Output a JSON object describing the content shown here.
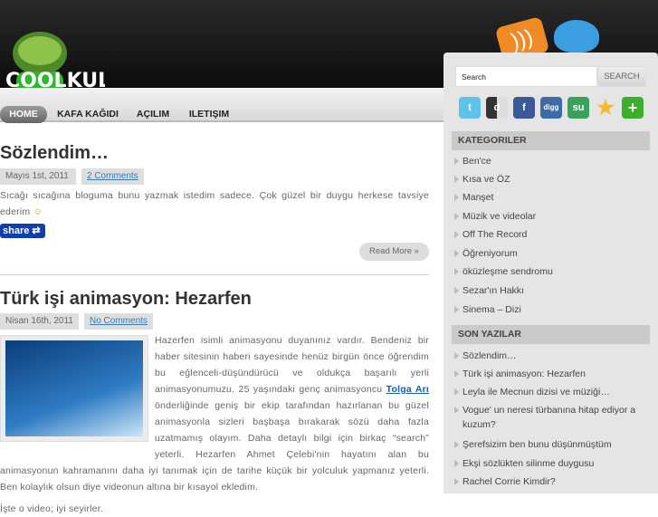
{
  "site": {
    "logo_text": "COOLKUL"
  },
  "nav": [
    "HOME",
    "KAFA KAĞIDI",
    "AÇILIM",
    "ILETIŞIM"
  ],
  "posts": [
    {
      "title": "Sözlendim…",
      "date": "Mayıs 1st, 2011",
      "comments": "2 Comments",
      "body": "Sıcağı sıcağına bloguma bunu yazmak istedim sadece. Çok güzel bir duygu herkese tavsiye ederim",
      "share": "share",
      "read_more": "Read More »"
    },
    {
      "title": "Türk işi animasyon: Hezarfen",
      "date": "Nisan 16th, 2011",
      "comments": "No Comments",
      "body_a": "Hazerfen isimli animasyonu duyanınız vardır. Bendeniz bir haber sitesinin haberi sayesinde henüz birgün önce öğrendim bu eğlenceli-düşündürücü ve oldukça başarılı yerli animasyonumuzu. 25 yaşındaki genç animasyoncu ",
      "link": "Tolga Arı",
      "body_b": " önderliğinde geniş bir ekip tarafından hazırlanan bu güzel animasyonla sizleri başbaşa bırakarak sözü daha fazla uzatmamış olayım. Daha detaylı bilgi için birkaç “search” yeterli. Hezarfen Ahmet Çelebi'nin hayatını alan bu animasyonun kahramanını daha iyi tanımak için de tarihe küçük bir yolculuk yapmanız yeterli. Ben kolaylık olsun diye videonun altına bir kısayol ekledim.",
      "body_c": "İşte o video; iyi seyirler."
    }
  ],
  "sidebar": {
    "search_placeholder": "Search",
    "search_button": "SEARCH",
    "social": [
      "t",
      "d",
      "f",
      "digg",
      "su",
      "★",
      "+"
    ],
    "categories_title": "KATEGORILER",
    "categories": [
      "Ben'ce",
      "Kısa ve ÖZ",
      "Manşet",
      "Müzik ve videolar",
      "Off The Record",
      "Öğreniyorum",
      "öküzleşme sendromu",
      "Sezar'ın Hakkı",
      "Sinema – Dizi"
    ],
    "recent_title": "SON YAZILAR",
    "recent": [
      "Sözlendim…",
      "Türk işi animasyon: Hezarfen",
      "Leyla ile Mecnun dizisi ve müziği…",
      "Vogue' un neresi türbanına hitap ediyor a kuzum?",
      "Şerefsizim ben bunu düşünmüştüm",
      "Ekşi sözlükten silinme duygusu",
      "Rachel Corrie Kimdir?"
    ]
  }
}
